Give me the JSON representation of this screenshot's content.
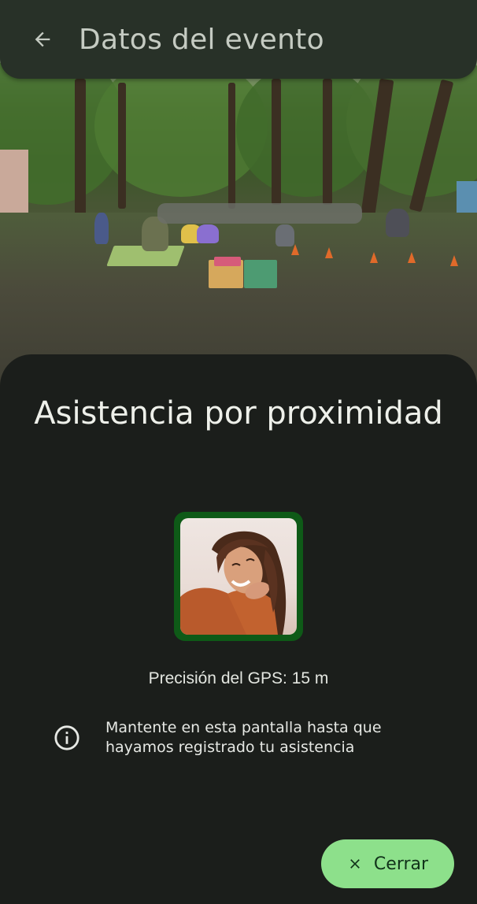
{
  "app_bar": {
    "title": "Datos del evento",
    "back_icon": "arrow-left-icon"
  },
  "photo": {
    "subject": "event-photo"
  },
  "sheet": {
    "title": "Asistencia por proximidad",
    "gps_accuracy": "Precisión del GPS: 15 m",
    "info_text": "Mantente en esta pantalla hasta que hayamos registrado tu asistencia",
    "info_icon": "info-icon",
    "close_label": "Cerrar",
    "close_icon": "close-icon"
  },
  "colors": {
    "app_bar_bg": "#283128",
    "sheet_bg": "#1b1e1b",
    "avatar_border": "#0e5a17",
    "button_bg": "#8de08b",
    "button_text": "#11331a"
  }
}
